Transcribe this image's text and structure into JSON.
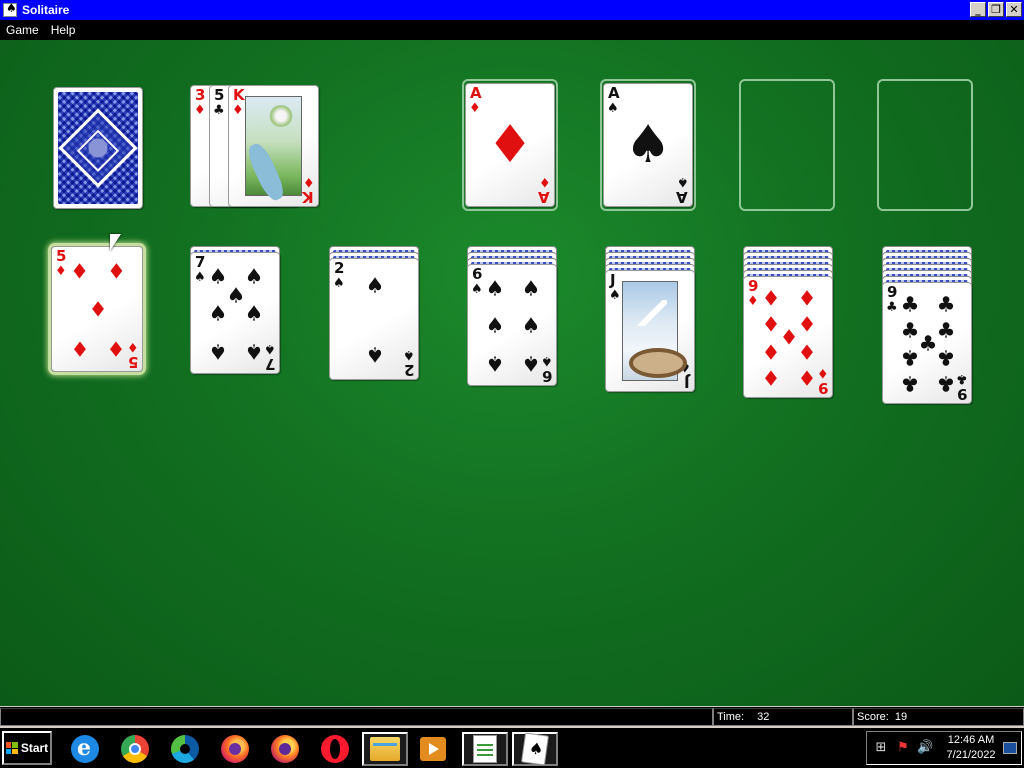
{
  "window": {
    "title": "Solitaire",
    "minimize_label": "_",
    "restore_label": "❐",
    "close_label": "✕"
  },
  "menu": [
    "Game",
    "Help"
  ],
  "game": {
    "stock": {
      "face": "down"
    },
    "waste": [
      {
        "rank": "3",
        "suit": "♦",
        "color": "red"
      },
      {
        "rank": "5",
        "suit": "♣",
        "color": "black"
      },
      {
        "rank": "K",
        "suit": "♦",
        "color": "red",
        "art": "spring"
      }
    ],
    "foundations": [
      {
        "rank": "A",
        "suit": "♦",
        "color": "red"
      },
      {
        "rank": "A",
        "suit": "♠",
        "color": "black"
      },
      null,
      null
    ],
    "tableau": [
      {
        "down": 0,
        "up": {
          "rank": "5",
          "suit": "♦",
          "color": "red",
          "selected": true
        }
      },
      {
        "down": 1,
        "up": {
          "rank": "7",
          "suit": "♠",
          "color": "black"
        }
      },
      {
        "down": 2,
        "up": {
          "rank": "2",
          "suit": "♠",
          "color": "black"
        }
      },
      {
        "down": 3,
        "up": {
          "rank": "6",
          "suit": "♠",
          "color": "black"
        }
      },
      {
        "down": 4,
        "up": {
          "rank": "J",
          "suit": "♠",
          "color": "black",
          "art": "winter"
        }
      },
      {
        "down": 5,
        "up": {
          "rank": "9",
          "suit": "♦",
          "color": "red"
        }
      },
      {
        "down": 6,
        "up": {
          "rank": "9",
          "suit": "♣",
          "color": "black"
        }
      }
    ]
  },
  "status": {
    "time_label": "Time:",
    "time_value": "32",
    "score_label": "Score:",
    "score_value": "19"
  },
  "taskbar": {
    "start_label": "Start",
    "apps": [
      "internet-explorer",
      "chrome",
      "edge",
      "firefox",
      "firefox-dev",
      "opera",
      "file-explorer",
      "media-player",
      "text-editor",
      "solitaire"
    ],
    "clock_time": "12:46 AM",
    "clock_date": "7/21/2022"
  }
}
